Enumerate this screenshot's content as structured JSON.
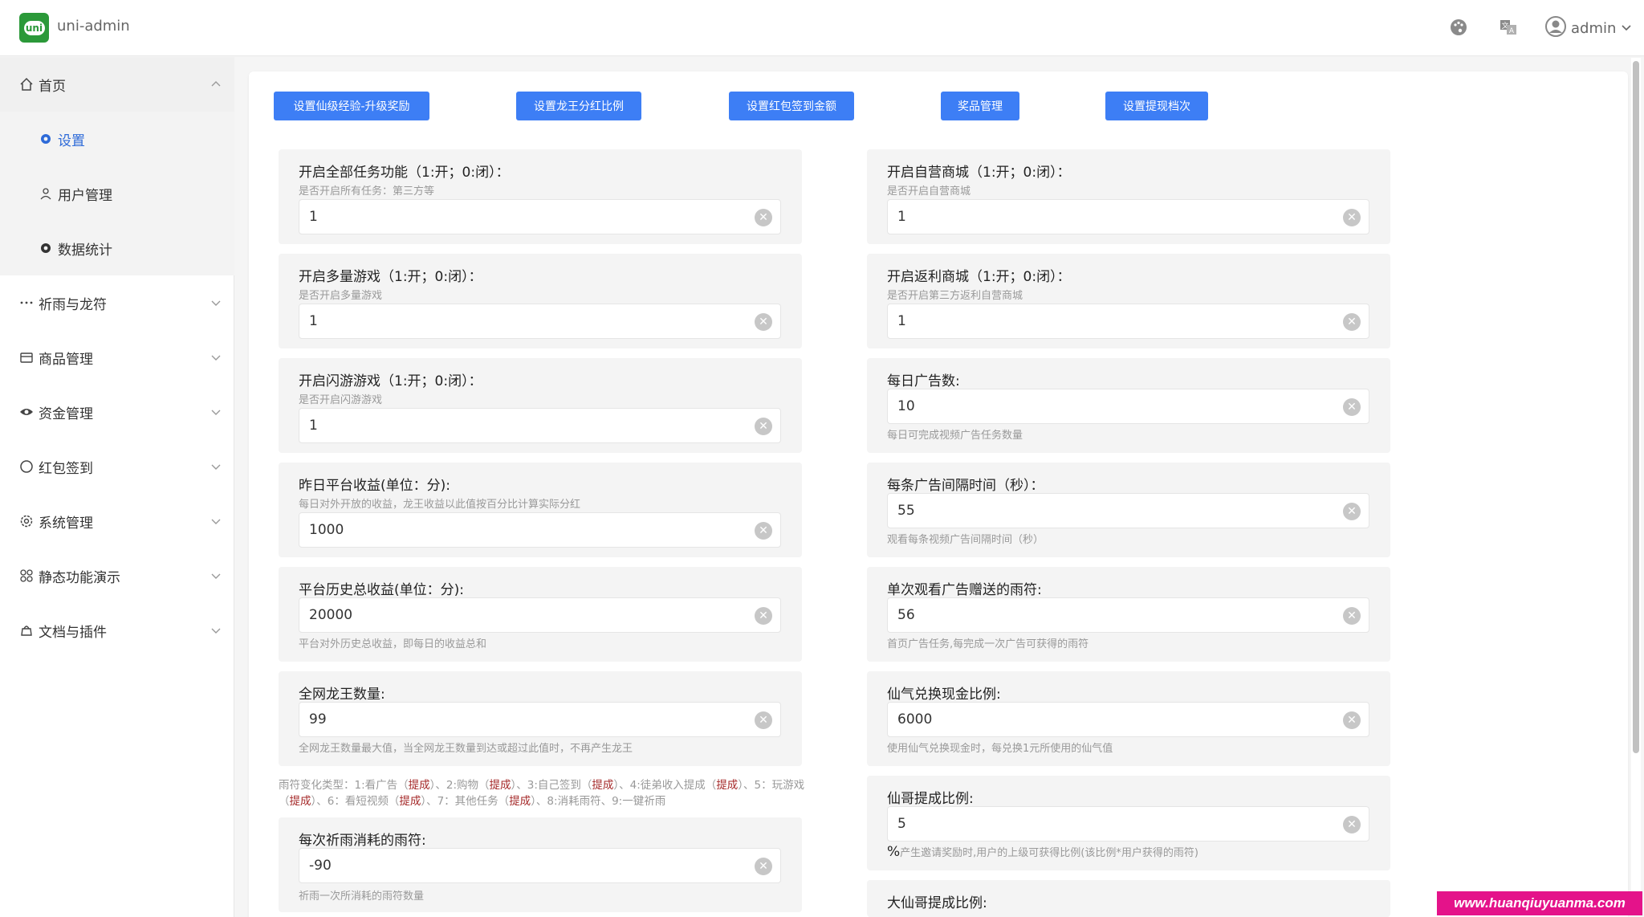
{
  "app": {
    "title": "uni-admin",
    "logo_text": "uni"
  },
  "header": {
    "user": "admin"
  },
  "sidebar": {
    "items": [
      {
        "label": "首页",
        "icon": "home-icon"
      },
      {
        "label": "祈雨与龙符",
        "icon": "more-icon"
      },
      {
        "label": "商品管理",
        "icon": "shop-icon"
      },
      {
        "label": "资金管理",
        "icon": "eye-icon"
      },
      {
        "label": "红包签到",
        "icon": "circle-icon"
      },
      {
        "label": "系统管理",
        "icon": "gear-icon"
      },
      {
        "label": "静态功能演示",
        "icon": "grid-icon"
      },
      {
        "label": "文档与插件",
        "icon": "bag-icon"
      }
    ],
    "sub_items": [
      {
        "label": "设置",
        "icon": "gear-icon",
        "active": true
      },
      {
        "label": "用户管理",
        "icon": "user-icon"
      },
      {
        "label": "数据统计",
        "icon": "gear-icon"
      }
    ]
  },
  "toolbar": {
    "buttons": [
      "设置仙级经验-升级奖励",
      "设置龙王分红比例",
      "设置红包签到金额",
      "奖品管理",
      "设置提现档次"
    ]
  },
  "left_fields": [
    {
      "title": "开启全部任务功能（1:开；0:闭）：",
      "desc": "是否开启所有任务：第三方等",
      "value": "1"
    },
    {
      "title": "开启多量游戏（1:开；0:闭）：",
      "desc": "是否开启多量游戏",
      "value": "1"
    },
    {
      "title": "开启闪游游戏（1:开；0:闭）：",
      "desc": "是否开启闪游游戏",
      "value": "1"
    },
    {
      "title": "昨日平台收益(单位：分):",
      "desc": "每日对外开放的收益，龙王收益以此值按百分比计算实际分红",
      "value": "1000"
    },
    {
      "title": "平台历史总收益(单位：分):",
      "desc": "平台对外历史总收益，即每日的收益总和",
      "value": "20000"
    },
    {
      "title": "全网龙王数量:",
      "desc": "全网龙王数量最大值，当全网龙王数量到达或超过此值时，不再产生龙王",
      "value": "99"
    },
    {
      "title": "每次祈雨消耗的雨符:",
      "desc": "祈雨一次所消耗的雨符数量",
      "value": "-90"
    }
  ],
  "right_fields": [
    {
      "title": "开启自营商城（1:开；0:闭）：",
      "desc": "是否开启自营商城",
      "value": "1"
    },
    {
      "title": "开启返利商城（1:开；0:闭）：",
      "desc": "是否开启第三方返利自营商城",
      "value": "1"
    },
    {
      "title": "每日广告数:",
      "desc": "每日可完成视频广告任务数量",
      "value": "10"
    },
    {
      "title": "每条广告间隔时间（秒）：",
      "desc": "观看每条视频广告间隔时间（秒）",
      "value": "55"
    },
    {
      "title": "单次观看广告赠送的雨符:",
      "desc": "首页广告任务,每完成一次广告可获得的雨符",
      "value": "56"
    },
    {
      "title": "仙气兑换现金比例:",
      "desc": "使用仙气兑换现金时，每兑换1元所使用的仙气值",
      "value": "6000"
    },
    {
      "title": "仙哥提成比例:",
      "desc_prefix": "%",
      "desc": "产生邀请奖励时,用户的上级可获得比例(该比例*用户获得的雨符)",
      "value": "5"
    },
    {
      "title": "大仙哥提成比例:"
    }
  ],
  "note": {
    "p1": "雨符变化类型：1:看广告（",
    "h1": "提成",
    "p2": "）、2:购物（",
    "h2": "提成",
    "p3": "）、3:自己签到（",
    "h3": "提成",
    "p4": "）、4:徒弟收入提成（",
    "h4": "提成",
    "p5": "）、5：玩游戏（",
    "h5": "提成",
    "p6": "）、6：看短视频（",
    "h6": "提成",
    "p7": "）、7：其他任务（",
    "h7": "提成",
    "p8": "）、8:消耗雨符、9:一键祈雨"
  },
  "watermark": "www.huanqiuyuanma.com",
  "colors": {
    "primary": "#3d7ef5",
    "active": "#2d6ad8",
    "logo": "#2b9939",
    "highlight": "#a52a2a",
    "watermark": "#e4138a"
  }
}
